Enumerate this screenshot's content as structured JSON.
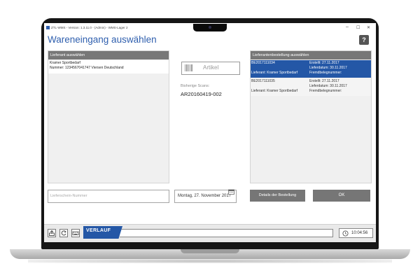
{
  "window": {
    "title": "ZTL-WMS - Version: 1.3.11.0 - (Admin) - WMS-Lager 2",
    "minimize": "–",
    "maximize": "☐",
    "close": "✕"
  },
  "page": {
    "title": "Wareneingang auswählen",
    "help_label": "?"
  },
  "supplier_panel": {
    "header": "Lieferant auswählen",
    "rows": [
      {
        "name": "Kramer Sportbedarf",
        "detail": "Nummer: 1234567041747 Viersen Deutschland"
      }
    ]
  },
  "artikel": {
    "label": "Artikel"
  },
  "scans": {
    "label": "Bisherige Scans:",
    "value": "AR20160419-002"
  },
  "order_panel": {
    "header": "Lieferantenbestellung auswählen",
    "rows": [
      {
        "selected": true,
        "order_no": "BE2017111034",
        "supplier": "Lieferant: Kramer Sportbedarf",
        "created": "Erstellt: 27.11.2017",
        "delivery": "Lieferdatum: 30.11.2017",
        "foreign": "Fremdbelegnummer:"
      },
      {
        "selected": false,
        "order_no": "BE2017111035",
        "supplier": "Lieferant: Kramer Sportbedarf",
        "created": "Erstellt: 27.11.2017",
        "delivery": "Lieferdatum: 30.11.2017",
        "foreign": "Fremdbelegnummer:"
      }
    ]
  },
  "form": {
    "delivery_note_placeholder": "Lieferschein-Nummer",
    "delivery_note_value": "",
    "date": "Montag, 27. November 2017",
    "details_button": "Details der Bestellung",
    "ok_button": "OK"
  },
  "bottom_bar": {
    "verlauf_label": "VERLAUF",
    "time": "10:04:56"
  },
  "colors": {
    "accent": "#2457a6",
    "title": "#2f5fae",
    "panel_header": "#777777",
    "button": "#767676"
  }
}
